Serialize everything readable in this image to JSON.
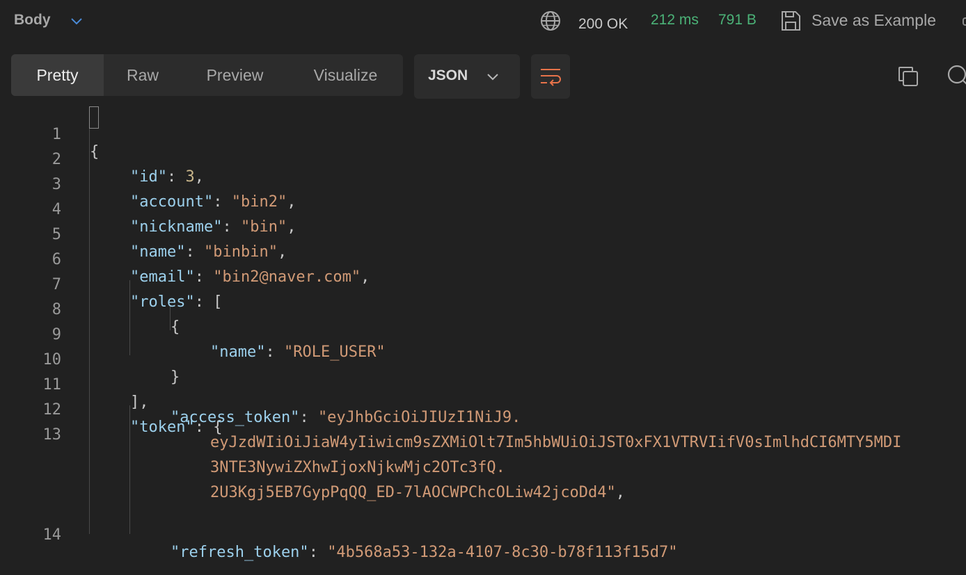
{
  "header": {
    "body_label": "Body",
    "status_code": "200 OK",
    "response_time": "212 ms",
    "response_size": "791 B",
    "save_label": "Save as Example"
  },
  "tabs": [
    {
      "label": "Pretty",
      "active": true
    },
    {
      "label": "Raw",
      "active": false
    },
    {
      "label": "Preview",
      "active": false
    },
    {
      "label": "Visualize",
      "active": false
    }
  ],
  "format": {
    "selected": "JSON"
  },
  "icons": [
    "chevron-down-icon",
    "globe-icon",
    "save-icon",
    "wrap-lines-icon",
    "copy-icon",
    "search-icon"
  ],
  "colors": {
    "background": "#212121",
    "status_ok": "#4bb277",
    "key": "#9cd0ec",
    "string": "#d19a76",
    "accent": "#e8734a"
  },
  "code": {
    "line_numbers": [
      "1",
      "2",
      "3",
      "4",
      "5",
      "6",
      "7",
      "8",
      "9",
      "10",
      "11",
      "12",
      "13",
      "14"
    ],
    "lines": {
      "l1_open": "{",
      "l2_key": "\"id\"",
      "l2_val": "3",
      "l3_key": "\"account\"",
      "l3_val": "\"bin2\"",
      "l4_key": "\"nickname\"",
      "l4_val": "\"bin\"",
      "l5_key": "\"name\"",
      "l5_val": "\"binbin\"",
      "l6_key": "\"email\"",
      "l6_val": "\"bin2@naver.com\"",
      "l7_key": "\"roles\"",
      "l7_open": "[",
      "l8_open": "{",
      "l9_key": "\"name\"",
      "l9_val": "\"ROLE_USER\"",
      "l10_close": "}",
      "l11_close": "],",
      "l12_key": "\"token\"",
      "l12_open": "{",
      "l13_key": "\"access_token\"",
      "l13_val_1": "\"eyJhbGciOiJIUzI1NiJ9.",
      "l13_val_2": "eyJzdWIiOiJiaW4yIiwicm9sZXMiOlt7Im5hbWUiOiJST0xFX1VTRVIifV0sImlhdCI6MTY5MDI",
      "l13_val_3": "3NTE3NywiZXhwIjoxNjkwMjc2OTc3fQ.",
      "l13_val_4": "2U3Kgj5EB7GypPqQQ_ED-7lAOCWPChcOLiw42jcoDd4\"",
      "l14_key": "\"refresh_token\"",
      "l14_val": "\"4b568a53-132a-4107-8c30-b78f113f15d7\""
    }
  }
}
